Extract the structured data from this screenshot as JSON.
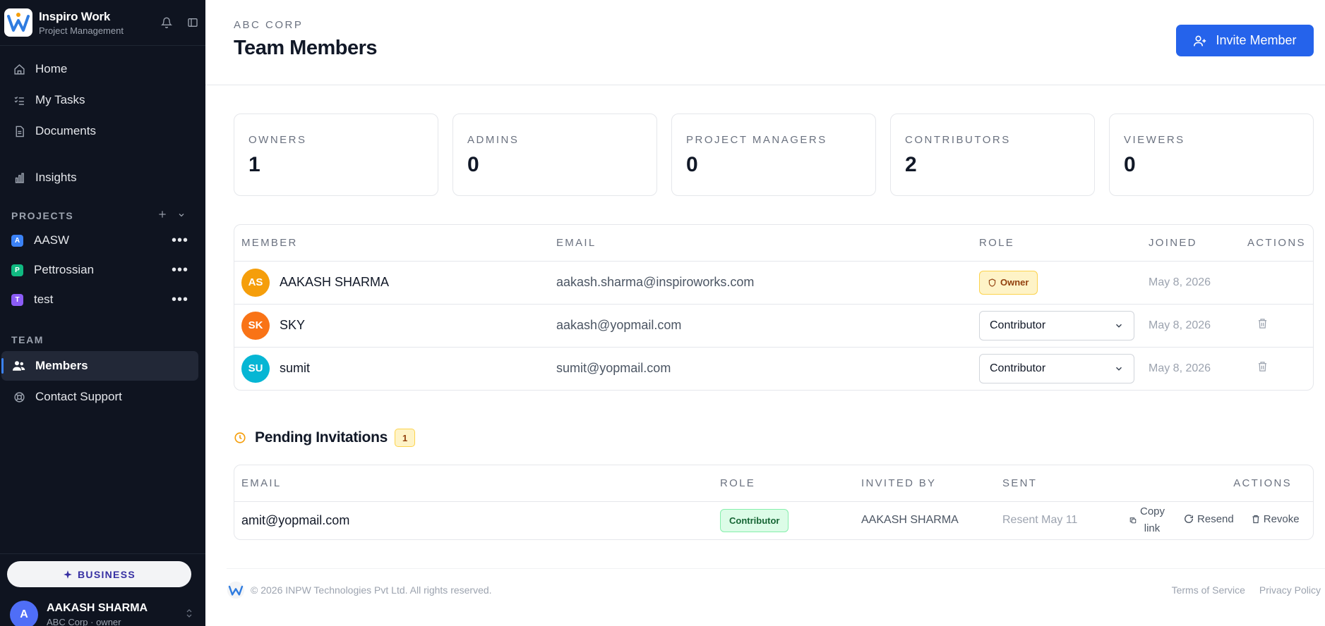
{
  "brand": {
    "name": "Inspiro Work",
    "subtitle": "Project Management",
    "logo_letter": "W"
  },
  "nav": [
    {
      "label": "Home",
      "icon": "home-icon"
    },
    {
      "label": "My Tasks",
      "icon": "tasks-icon"
    },
    {
      "label": "Documents",
      "icon": "document-icon"
    },
    {
      "label": "Insights",
      "icon": "chart-icon"
    }
  ],
  "projects": {
    "label": "PROJECTS",
    "items": [
      {
        "initial": "A",
        "name": "AASW",
        "color": "#3b82f6"
      },
      {
        "initial": "P",
        "name": "Pettrossian",
        "color": "#10b981"
      },
      {
        "initial": "T",
        "name": "test",
        "color": "#8b5cf6"
      }
    ]
  },
  "team": {
    "label": "TEAM",
    "items": [
      {
        "label": "Members",
        "icon": "members-icon",
        "active": true
      },
      {
        "label": "Contact Support",
        "icon": "support-icon",
        "active": false
      }
    ]
  },
  "plan": {
    "label": "BUSINESS"
  },
  "user": {
    "initial": "A",
    "name": "AAKASH SHARMA",
    "subtitle": "ABC Corp · owner"
  },
  "header": {
    "org": "ABC CORP",
    "title": "Team Members",
    "invite_label": "Invite Member"
  },
  "stats": [
    {
      "label": "OWNERS",
      "value": "1"
    },
    {
      "label": "ADMINS",
      "value": "0"
    },
    {
      "label": "PROJECT MANAGERS",
      "value": "0"
    },
    {
      "label": "CONTRIBUTORS",
      "value": "2"
    },
    {
      "label": "VIEWERS",
      "value": "0"
    }
  ],
  "members_table": {
    "headers": [
      "MEMBER",
      "EMAIL",
      "ROLE",
      "JOINED",
      "ACTIONS"
    ],
    "rows": [
      {
        "initials": "AS",
        "avatar_color": "#f59e0b",
        "name": "AAKASH SHARMA",
        "email": "aakash.sharma@inspiroworks.com",
        "role": "Owner",
        "joined": "May 8, 2026"
      },
      {
        "initials": "SK",
        "avatar_color": "#f97316",
        "name": "SKY",
        "email": "aakash@yopmail.com",
        "role": "Contributor",
        "joined": "May 8, 2026"
      },
      {
        "initials": "SU",
        "avatar_color": "#06b6d4",
        "name": "sumit",
        "email": "sumit@yopmail.com",
        "role": "Contributor",
        "joined": "May 8, 2026"
      }
    ]
  },
  "pending": {
    "title": "Pending Invitations",
    "count": "1",
    "headers": [
      "EMAIL",
      "ROLE",
      "INVITED BY",
      "SENT",
      "ACTIONS"
    ],
    "rows": [
      {
        "email": "amit@yopmail.com",
        "role": "Contributor",
        "invited_by": "AAKASH SHARMA",
        "sent": "Resent May 11",
        "copy_label": "Copy link",
        "resend_label": "Resend",
        "revoke_label": "Revoke"
      }
    ]
  },
  "footer": {
    "copyright": "© 2026 INPW Technologies Pvt Ltd. All rights reserved.",
    "terms": "Terms of Service",
    "privacy": "Privacy Policy"
  }
}
